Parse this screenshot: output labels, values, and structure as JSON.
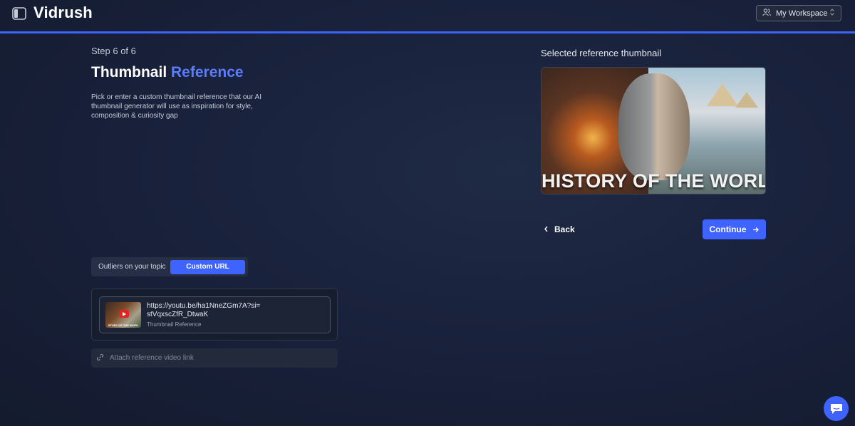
{
  "app": {
    "logo_text": "Vidrush",
    "workspace_label": "My Workspace",
    "progress_fraction": 1.0
  },
  "wizard": {
    "step_text": "Step 6 of 6",
    "title_main": "Thumbnail",
    "title_accent": "Reference",
    "description": "Pick or enter a custom thumbnail reference that our AI thumbnail generator will use as inspiration for style, composition & curiosity gap",
    "toggle": {
      "options": [
        "Outliers on your topic",
        "Custom URL"
      ],
      "selected": "Custom URL"
    },
    "reference": {
      "url": "https://youtu.be/ha1NneZGm7A?si=stVqxscZfR_DtwaK",
      "subtitle": "Thumbnail Reference",
      "thumb_caption": "STORY OF THE WORL"
    },
    "attach": {
      "placeholder": "Attach reference video link",
      "value": ""
    }
  },
  "preview": {
    "heading": "Selected reference thumbnail",
    "thumbnail_text": "HISTORY OF THE WORLD"
  },
  "actions": {
    "back_label": "Back",
    "continue_label": "Continue"
  },
  "colors": {
    "accent": "#3f63ff",
    "title_accent": "#5b7cff",
    "background": "#1a2236"
  },
  "icons": [
    "sidebar-toggle-icon",
    "users-icon",
    "chevron-updown-icon",
    "link-icon",
    "chevron-left-icon",
    "arrow-right-icon",
    "chat-icon",
    "play-icon"
  ]
}
